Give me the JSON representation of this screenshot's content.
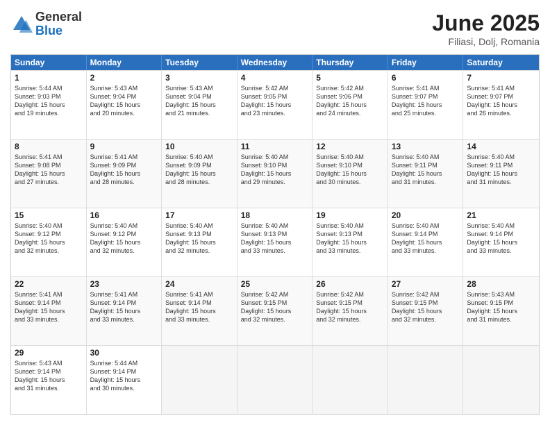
{
  "logo": {
    "general": "General",
    "blue": "Blue"
  },
  "title": {
    "month": "June 2025",
    "location": "Filiasi, Dolj, Romania"
  },
  "days": [
    "Sunday",
    "Monday",
    "Tuesday",
    "Wednesday",
    "Thursday",
    "Friday",
    "Saturday"
  ],
  "rows": [
    [
      {
        "day": "",
        "text": "",
        "empty": true
      },
      {
        "day": "",
        "text": "",
        "empty": true
      },
      {
        "day": "",
        "text": "",
        "empty": true
      },
      {
        "day": "",
        "text": "",
        "empty": true
      },
      {
        "day": "",
        "text": "",
        "empty": true
      },
      {
        "day": "",
        "text": "",
        "empty": true
      },
      {
        "day": "",
        "text": "",
        "empty": true
      }
    ],
    [
      {
        "day": "1",
        "text": "Sunrise: 5:44 AM\nSunset: 9:03 PM\nDaylight: 15 hours\nand 19 minutes.",
        "empty": false
      },
      {
        "day": "2",
        "text": "Sunrise: 5:43 AM\nSunset: 9:04 PM\nDaylight: 15 hours\nand 20 minutes.",
        "empty": false
      },
      {
        "day": "3",
        "text": "Sunrise: 5:43 AM\nSunset: 9:04 PM\nDaylight: 15 hours\nand 21 minutes.",
        "empty": false
      },
      {
        "day": "4",
        "text": "Sunrise: 5:42 AM\nSunset: 9:05 PM\nDaylight: 15 hours\nand 23 minutes.",
        "empty": false
      },
      {
        "day": "5",
        "text": "Sunrise: 5:42 AM\nSunset: 9:06 PM\nDaylight: 15 hours\nand 24 minutes.",
        "empty": false
      },
      {
        "day": "6",
        "text": "Sunrise: 5:41 AM\nSunset: 9:07 PM\nDaylight: 15 hours\nand 25 minutes.",
        "empty": false
      },
      {
        "day": "7",
        "text": "Sunrise: 5:41 AM\nSunset: 9:07 PM\nDaylight: 15 hours\nand 26 minutes.",
        "empty": false
      }
    ],
    [
      {
        "day": "8",
        "text": "Sunrise: 5:41 AM\nSunset: 9:08 PM\nDaylight: 15 hours\nand 27 minutes.",
        "empty": false
      },
      {
        "day": "9",
        "text": "Sunrise: 5:41 AM\nSunset: 9:09 PM\nDaylight: 15 hours\nand 28 minutes.",
        "empty": false
      },
      {
        "day": "10",
        "text": "Sunrise: 5:40 AM\nSunset: 9:09 PM\nDaylight: 15 hours\nand 28 minutes.",
        "empty": false
      },
      {
        "day": "11",
        "text": "Sunrise: 5:40 AM\nSunset: 9:10 PM\nDaylight: 15 hours\nand 29 minutes.",
        "empty": false
      },
      {
        "day": "12",
        "text": "Sunrise: 5:40 AM\nSunset: 9:10 PM\nDaylight: 15 hours\nand 30 minutes.",
        "empty": false
      },
      {
        "day": "13",
        "text": "Sunrise: 5:40 AM\nSunset: 9:11 PM\nDaylight: 15 hours\nand 31 minutes.",
        "empty": false
      },
      {
        "day": "14",
        "text": "Sunrise: 5:40 AM\nSunset: 9:11 PM\nDaylight: 15 hours\nand 31 minutes.",
        "empty": false
      }
    ],
    [
      {
        "day": "15",
        "text": "Sunrise: 5:40 AM\nSunset: 9:12 PM\nDaylight: 15 hours\nand 32 minutes.",
        "empty": false
      },
      {
        "day": "16",
        "text": "Sunrise: 5:40 AM\nSunset: 9:12 PM\nDaylight: 15 hours\nand 32 minutes.",
        "empty": false
      },
      {
        "day": "17",
        "text": "Sunrise: 5:40 AM\nSunset: 9:13 PM\nDaylight: 15 hours\nand 32 minutes.",
        "empty": false
      },
      {
        "day": "18",
        "text": "Sunrise: 5:40 AM\nSunset: 9:13 PM\nDaylight: 15 hours\nand 33 minutes.",
        "empty": false
      },
      {
        "day": "19",
        "text": "Sunrise: 5:40 AM\nSunset: 9:13 PM\nDaylight: 15 hours\nand 33 minutes.",
        "empty": false
      },
      {
        "day": "20",
        "text": "Sunrise: 5:40 AM\nSunset: 9:14 PM\nDaylight: 15 hours\nand 33 minutes.",
        "empty": false
      },
      {
        "day": "21",
        "text": "Sunrise: 5:40 AM\nSunset: 9:14 PM\nDaylight: 15 hours\nand 33 minutes.",
        "empty": false
      }
    ],
    [
      {
        "day": "22",
        "text": "Sunrise: 5:41 AM\nSunset: 9:14 PM\nDaylight: 15 hours\nand 33 minutes.",
        "empty": false
      },
      {
        "day": "23",
        "text": "Sunrise: 5:41 AM\nSunset: 9:14 PM\nDaylight: 15 hours\nand 33 minutes.",
        "empty": false
      },
      {
        "day": "24",
        "text": "Sunrise: 5:41 AM\nSunset: 9:14 PM\nDaylight: 15 hours\nand 33 minutes.",
        "empty": false
      },
      {
        "day": "25",
        "text": "Sunrise: 5:42 AM\nSunset: 9:15 PM\nDaylight: 15 hours\nand 32 minutes.",
        "empty": false
      },
      {
        "day": "26",
        "text": "Sunrise: 5:42 AM\nSunset: 9:15 PM\nDaylight: 15 hours\nand 32 minutes.",
        "empty": false
      },
      {
        "day": "27",
        "text": "Sunrise: 5:42 AM\nSunset: 9:15 PM\nDaylight: 15 hours\nand 32 minutes.",
        "empty": false
      },
      {
        "day": "28",
        "text": "Sunrise: 5:43 AM\nSunset: 9:15 PM\nDaylight: 15 hours\nand 31 minutes.",
        "empty": false
      }
    ],
    [
      {
        "day": "29",
        "text": "Sunrise: 5:43 AM\nSunset: 9:14 PM\nDaylight: 15 hours\nand 31 minutes.",
        "empty": false
      },
      {
        "day": "30",
        "text": "Sunrise: 5:44 AM\nSunset: 9:14 PM\nDaylight: 15 hours\nand 30 minutes.",
        "empty": false
      },
      {
        "day": "",
        "text": "",
        "empty": true
      },
      {
        "day": "",
        "text": "",
        "empty": true
      },
      {
        "day": "",
        "text": "",
        "empty": true
      },
      {
        "day": "",
        "text": "",
        "empty": true
      },
      {
        "day": "",
        "text": "",
        "empty": true
      }
    ]
  ]
}
